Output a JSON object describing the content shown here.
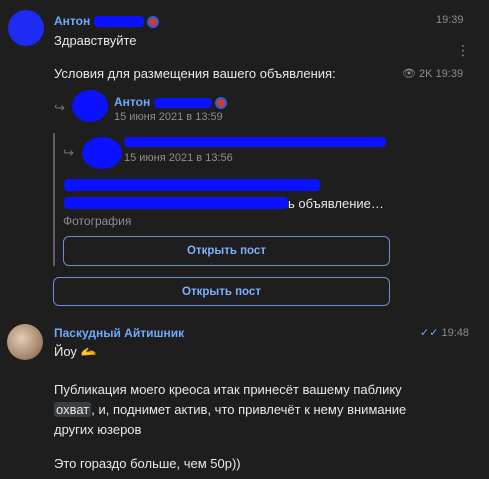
{
  "msg1": {
    "author": "Антон",
    "time": "19:39",
    "text": "Здравствуйте",
    "more": "⋮"
  },
  "msg2": {
    "text": "Условия для размещения вашего объявления:",
    "views": "2K",
    "time": "19:39"
  },
  "fwd1": {
    "author": "Антон",
    "date": "15 июня 2021 в 13:59"
  },
  "fwd2": {
    "date": "15 июня 2021 в 13:56",
    "line2": "ь объявление…",
    "photo_label": "Фотография",
    "button": "Открыть пост"
  },
  "outer_button": "Открыть пост",
  "msg3": {
    "author": "Паскудный Айтишник",
    "time": "19:48",
    "line1": "Йоу 🫴",
    "para1_a": "Публикация моего креоса итак принесёт вашему паблику",
    "chip": "охват",
    "para1_b": ", и, поднимет актив, что привлечёт к нему внимание",
    "para1_c": "других юзеров",
    "para2": "Это гораздо больше, чем 50р))"
  }
}
